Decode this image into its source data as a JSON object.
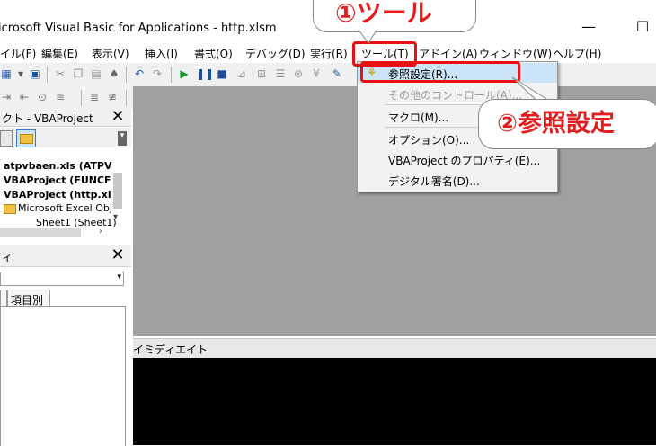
{
  "window": {
    "title": "icrosoft Visual Basic for Applications - http.xlsm",
    "minimize": "—",
    "maximize": "☐",
    "close": "✕"
  },
  "menubar": {
    "items": [
      "イル(F)",
      "編集(E)",
      "表示(V)",
      "挿入(I)",
      "書式(O)",
      "デバッグ(D)",
      "実行(R)",
      "ツール(T)",
      "アドイン(A)",
      "ウィンドウ(W)",
      "ヘルプ(H)"
    ]
  },
  "project_pane": {
    "title": "クト - VBAProject",
    "close": "✕",
    "tree": [
      "atpvbaen.xls (ATPV",
      "VBAProject (FUNCF",
      "VBAProject (http.xl",
      "Microsoft Excel Obj",
      "Sheet1 (Sheet1)"
    ]
  },
  "props_pane": {
    "title": "ィ",
    "close": "✕",
    "tab_categorized": "項目別"
  },
  "immediate": {
    "title": "イミディエイト"
  },
  "tools_menu": {
    "items": [
      {
        "label": "参照設定(R)...",
        "enabled": true
      },
      {
        "label": "その他のコントロール(A)...",
        "enabled": false
      },
      {
        "label": "マクロ(M)...",
        "enabled": true
      },
      {
        "label": "オプション(O)...",
        "enabled": true
      },
      {
        "label": "VBAProject のプロパティ(E)...",
        "enabled": true
      },
      {
        "label": "デジタル署名(D)...",
        "enabled": true
      }
    ]
  },
  "annotations": {
    "step1": "①ツール",
    "step2": "②参照設定"
  },
  "colors": {
    "accent_red": "#e81010",
    "highlight": "#cce4f7",
    "workspace": "#a0a0a0"
  }
}
